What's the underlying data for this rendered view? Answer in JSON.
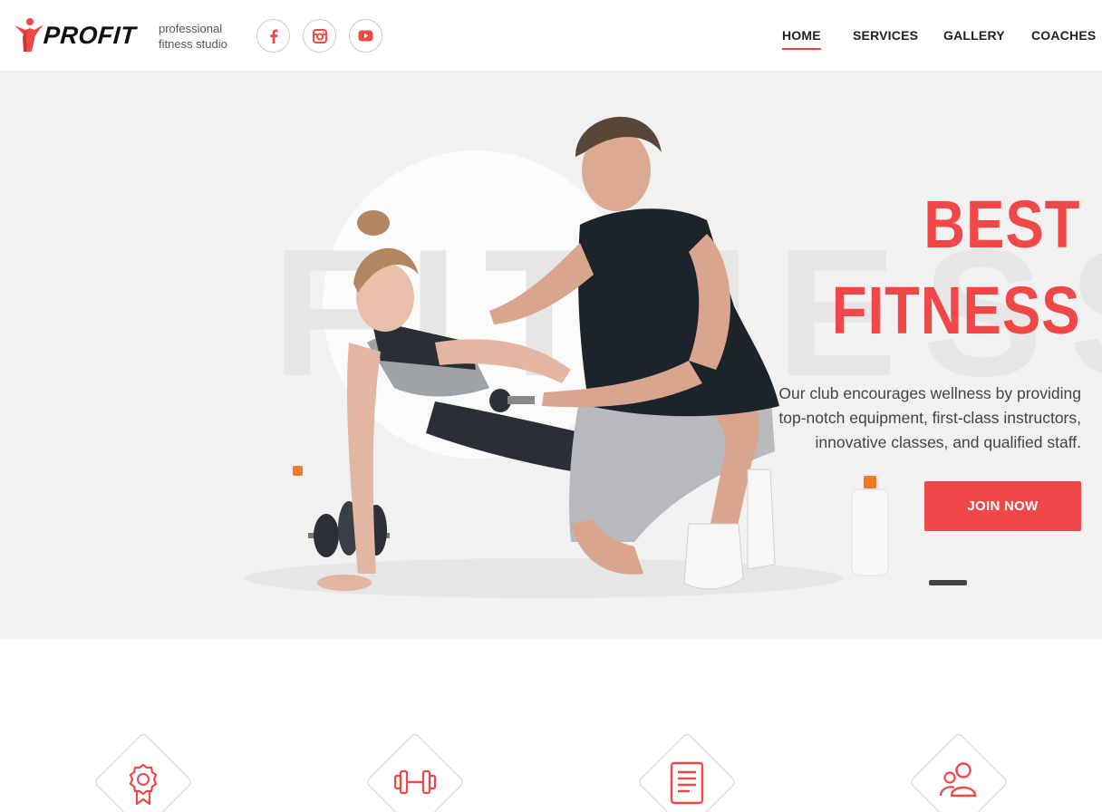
{
  "brand": {
    "logo_text": "PROFIT",
    "tagline_line1": "professional",
    "tagline_line2": "fitness studio",
    "accent_color": "#f04848"
  },
  "social": [
    {
      "name": "facebook-icon"
    },
    {
      "name": "instagram-icon"
    },
    {
      "name": "youtube-icon"
    }
  ],
  "nav": {
    "home": "HOME",
    "services": "SERVICES",
    "gallery": "GALLERY",
    "coaches": "COACHES",
    "active": "HOME"
  },
  "hero": {
    "background_word": "FITNESS",
    "title_line1": "BEST",
    "title_line2": "FITNESS",
    "description": "Our club encourages wellness by providing top-notch equipment, first-class instructors, innovative classes, and qualified staff.",
    "button_label": "JOIN NOW"
  },
  "features": [
    {
      "icon": "award-ribbon-icon"
    },
    {
      "icon": "dumbbell-icon"
    },
    {
      "icon": "document-icon"
    },
    {
      "icon": "users-icon"
    }
  ]
}
